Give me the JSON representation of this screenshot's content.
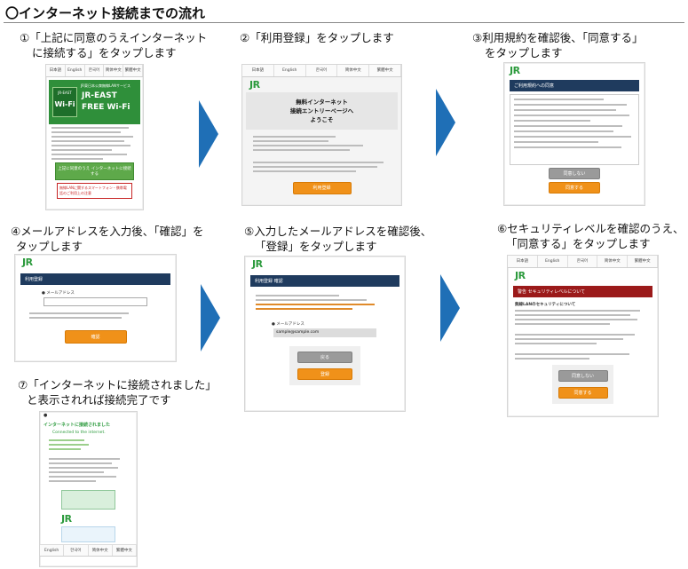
{
  "title": "〇インターネット接続までの流れ",
  "captions": {
    "s1a": "①「上記に同意のうえインターネット",
    "s1b": "に接続する」をタップします",
    "s2": "②「利用登録」をタップします",
    "s3a": "③利用規約を確認後、「同意する」",
    "s3b": "をタップします",
    "s4a": "④メールアドレスを入力後、「確認」を",
    "s4b": "タップします",
    "s5a": "⑤入力したメールアドレスを確認後、",
    "s5b": "「登録」をタップします",
    "s6a": "⑥セキュリティレベルを確認のうえ、",
    "s6b": "「同意する」をタップします",
    "s7a": "⑦「インターネットに接続されました」",
    "s7b": "と表示されれば接続完了です"
  },
  "screens": {
    "nav_items": [
      "日本語",
      "English",
      "한국어",
      "简体中文",
      "繁體中文"
    ],
    "jr_logo": "JR",
    "s1": {
      "brand_small": "JR東日本公衆無線LANサービス",
      "brand_main1": "JR-EAST",
      "brand_main2": "FREE Wi-Fi",
      "badge_top": "JR-EAST",
      "badge_bottom": "Wi-Fi",
      "green_button": "上記に同意のうえ インターネットに接続する",
      "red_notice": "無線LANに関するスマートフォン・携帯電話のご利用上の注意"
    },
    "s2": {
      "heading1": "無料インターネット",
      "heading2": "接続エントリーページへ",
      "heading3": "ようこそ",
      "button": "利用登録"
    },
    "s3": {
      "bar": "ご利用規約への同意",
      "btn_disagree": "同意しない",
      "btn_agree": "同意する"
    },
    "s4": {
      "bar": "利用登録",
      "field_label": "メールアドレス",
      "button": "確認"
    },
    "s5": {
      "bar": "利用登録 確認",
      "field_label": "メールアドレス",
      "email": "sample@sample.com",
      "btn_back": "戻る",
      "btn_register": "登録"
    },
    "s6": {
      "bar": "警告 セキュリティレベルについて",
      "subhead": "無線LANのセキュリティについて",
      "btn_disagree": "同意しない",
      "btn_agree": "同意する"
    },
    "s7": {
      "header": "インターネットに接続されました",
      "sub": "Connected to the internet."
    }
  },
  "colors": {
    "arrow": "#1f6fb6",
    "orange_button": "#f09119",
    "navy_bar": "#1f3b5e",
    "red_bar": "#9b1a1a",
    "jr_green": "#2b9a3c"
  }
}
